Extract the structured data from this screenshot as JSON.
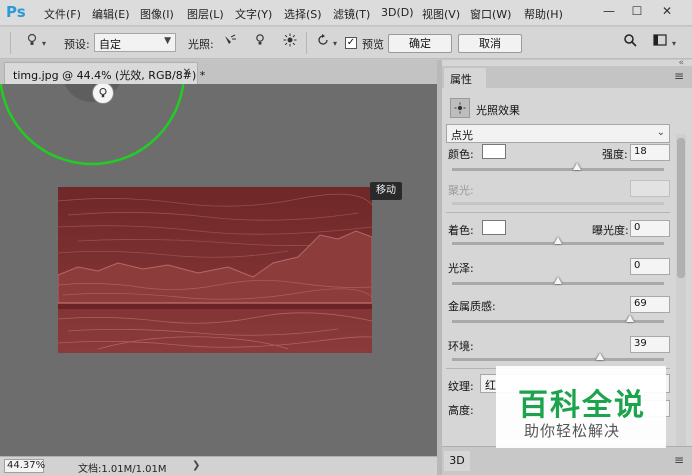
{
  "app": {
    "logo": "Ps"
  },
  "menu": {
    "items": [
      "文件(F)",
      "编辑(E)",
      "图像(I)",
      "图层(L)",
      "文字(Y)",
      "选择(S)",
      "滤镜(T)",
      "3D(D)",
      "视图(V)",
      "窗口(W)",
      "帮助(H)"
    ],
    "window_controls": [
      "—",
      "☐",
      "✕"
    ]
  },
  "options": {
    "preset_label": "预设:",
    "preset_value": "自定",
    "light_label": "光照:",
    "preview_label": "预览",
    "preview_checked": true,
    "ok_label": "确定",
    "cancel_label": "取消",
    "icons": [
      "light-bulb-icon",
      "spot-light-icon",
      "point-light-icon",
      "infinite-light-icon",
      "reset-icon",
      "search-icon",
      "workspace-icon"
    ]
  },
  "document": {
    "tab_title": "timg.jpg @ 44.4% (光效, RGB/8#) *",
    "tooltip": "移动"
  },
  "status": {
    "zoom": "44.37%",
    "doc_size": "文档:1.01M/1.01M"
  },
  "properties": {
    "tab_label": "属性",
    "effect_title": "光照效果",
    "light_type": "点光",
    "color_label": "颜色:",
    "intensity_label": "强度:",
    "intensity_value": "18",
    "intensity_fraction": 0.59,
    "hotspot_label": "聚光:",
    "hotspot_value": "",
    "coloring_label": "着色:",
    "exposure_label": "曝光度:",
    "exposure_value": "0",
    "exposure_fraction": 0.5,
    "gloss_label": "光泽:",
    "gloss_value": "0",
    "gloss_fraction": 0.5,
    "metallic_label": "金属质感:",
    "metallic_value": "69",
    "metallic_fraction": 0.84,
    "ambience_label": "环境:",
    "ambience_value": "39",
    "ambience_fraction": 0.7,
    "texture_label": "纹理:",
    "texture_value": "红",
    "height_label": "高度:",
    "footer_tab": "3D"
  },
  "watermark": {
    "main": "百科全说",
    "sub": "助你轻松解决"
  },
  "colors": {
    "image_base": "#7c2f30",
    "light_ring": "#22cc22",
    "watermark_green": "#1ba44b"
  }
}
